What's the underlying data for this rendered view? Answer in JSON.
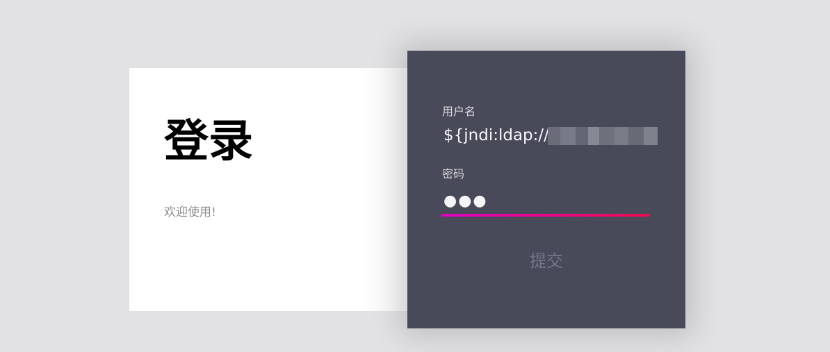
{
  "login_card": {
    "title": "登录",
    "subtitle": "欢迎使用!"
  },
  "form": {
    "username_label": "用户名",
    "username_value": "${jndi:ldap://",
    "password_label": "密码",
    "password_value": "●●●",
    "submit_label": "提交"
  },
  "colors": {
    "page_background": "#e2e2e4",
    "card_background": "#ffffff",
    "panel_background": "#484a59",
    "underline_start": "#e100c4",
    "underline_end": "#ef0b4f",
    "submit_text": "#74768a"
  },
  "icons": []
}
